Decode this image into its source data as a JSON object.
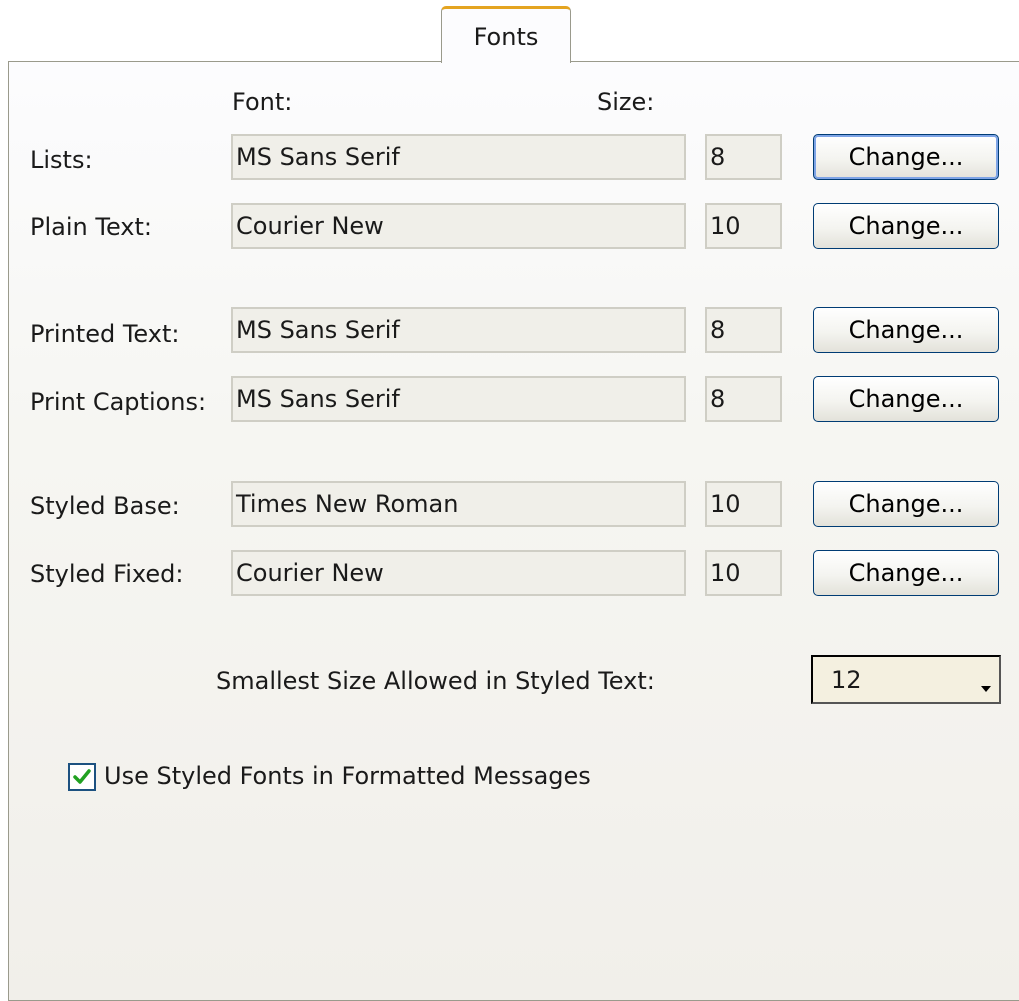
{
  "tab": {
    "label": "Fonts"
  },
  "headers": {
    "font": "Font:",
    "size": "Size:"
  },
  "rows": [
    {
      "label": "Lists:",
      "font": "MS Sans Serif",
      "size": "8",
      "button": "Change...",
      "default": true
    },
    {
      "label": "Plain Text:",
      "font": "Courier New",
      "size": "10",
      "button": "Change..."
    },
    {
      "label": "Printed Text:",
      "font": "MS Sans Serif",
      "size": "8",
      "button": "Change..."
    },
    {
      "label": "Print Captions:",
      "font": "MS Sans Serif",
      "size": "8",
      "button": "Change..."
    },
    {
      "label": "Styled Base:",
      "font": "Times New Roman",
      "size": "10",
      "button": "Change..."
    },
    {
      "label": "Styled Fixed:",
      "font": "Courier New",
      "size": "10",
      "button": "Change..."
    }
  ],
  "smallest": {
    "label": "Smallest Size Allowed in Styled Text:",
    "value": "12"
  },
  "checkbox": {
    "label": "Use Styled Fonts in Formatted Messages",
    "checked": true
  },
  "colors": {
    "tab_accent": "#e4a420",
    "button_border": "#003c74",
    "check_mark": "#21a121"
  }
}
